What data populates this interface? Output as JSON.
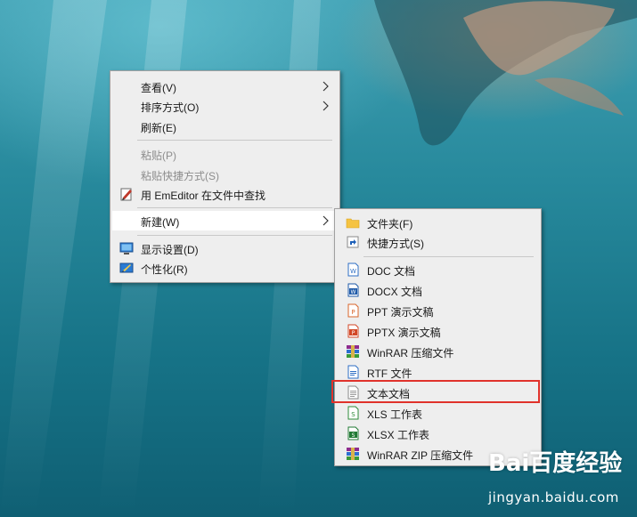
{
  "colors": {
    "menu_bg": "#eeeeee",
    "hover_bg": "#ffffff",
    "highlight_border": "#e0322b",
    "disabled_text": "#8d8d8d"
  },
  "context_menu": {
    "items": [
      {
        "label": "查看(V)",
        "submenu": true
      },
      {
        "label": "排序方式(O)",
        "submenu": true
      },
      {
        "label": "刷新(E)"
      },
      {
        "label": "粘贴(P)",
        "disabled": true
      },
      {
        "label": "粘贴快捷方式(S)",
        "disabled": true
      },
      {
        "label": "用 EmEditor 在文件中查找",
        "icon": "emeditor-icon"
      },
      {
        "label": "新建(W)",
        "submenu": true,
        "hovered": true
      },
      {
        "label": "显示设置(D)",
        "icon": "display-settings-icon"
      },
      {
        "label": "个性化(R)",
        "icon": "personalize-icon"
      }
    ]
  },
  "new_submenu": {
    "items": [
      {
        "label": "文件夹(F)",
        "icon": "folder-icon"
      },
      {
        "label": "快捷方式(S)",
        "icon": "shortcut-icon"
      },
      {
        "label": "DOC 文档",
        "icon": "word-doc-icon"
      },
      {
        "label": "DOCX 文档",
        "icon": "word-docx-icon"
      },
      {
        "label": "PPT 演示文稿",
        "icon": "ppt-icon"
      },
      {
        "label": "PPTX 演示文稿",
        "icon": "pptx-icon"
      },
      {
        "label": "WinRAR 压缩文件",
        "icon": "winrar-icon"
      },
      {
        "label": "RTF 文件",
        "icon": "rtf-icon"
      },
      {
        "label": "文本文档",
        "icon": "text-document-icon",
        "highlighted": true
      },
      {
        "label": "XLS 工作表",
        "icon": "xls-icon"
      },
      {
        "label": "XLSX 工作表",
        "icon": "xlsx-icon"
      },
      {
        "label": "WinRAR ZIP 压缩文件",
        "icon": "winrar-zip-icon"
      }
    ]
  },
  "watermark": {
    "logo": "Bai百度经验",
    "url": "jingyan.baidu.com"
  }
}
